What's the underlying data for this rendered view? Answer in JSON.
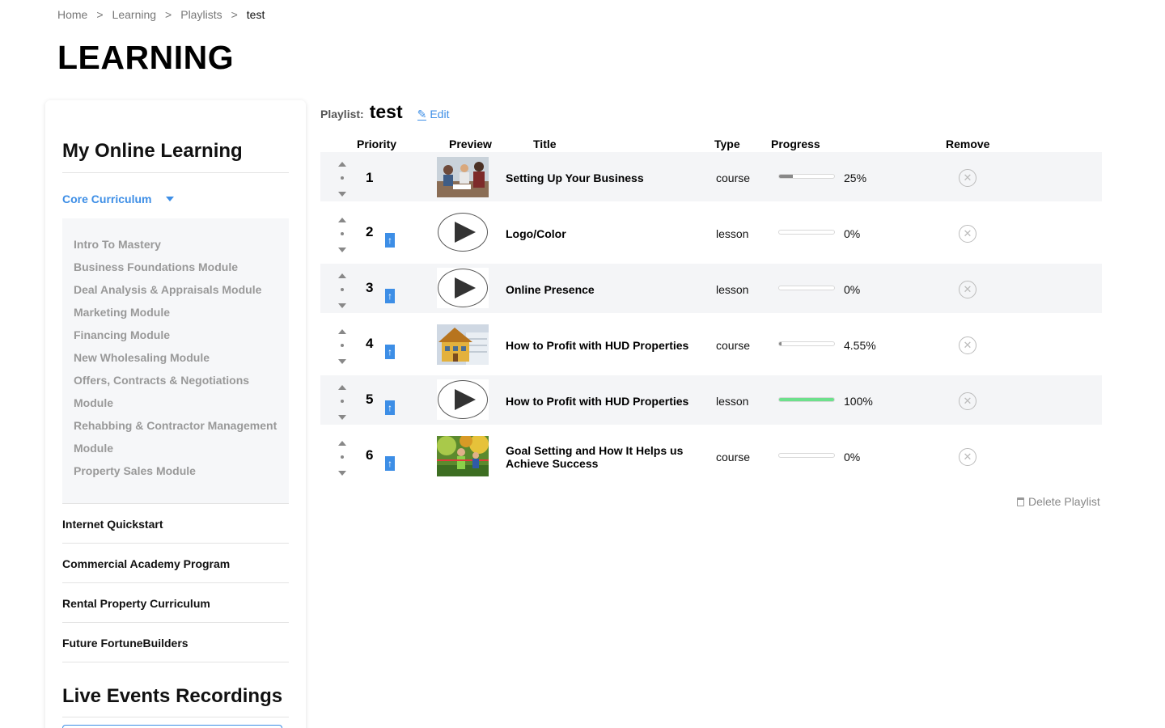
{
  "breadcrumb": {
    "items": [
      "Home",
      "Learning",
      "Playlists",
      "test"
    ],
    "separator": ">"
  },
  "page_title": "LEARNING",
  "sidebar": {
    "my_online_learning": "My Online Learning",
    "core_curriculum": "Core Curriculum",
    "modules": [
      "Intro To Mastery",
      "Business Foundations Module",
      "Deal Analysis & Appraisals Module",
      "Marketing Module",
      "Financing Module",
      "New Wholesaling Module",
      "Offers, Contracts & Negotiations",
      "Module",
      "Rehabbing & Contractor Management",
      "Module",
      "Property Sales Module"
    ],
    "programs": [
      "Internet Quickstart",
      "Commercial Academy Program",
      "Rental Property Curriculum",
      "Future FortuneBuilders"
    ],
    "live_events": "Live Events Recordings"
  },
  "playlist": {
    "label": "Playlist:",
    "name": "test",
    "edit_label": "Edit",
    "columns": {
      "priority": "Priority",
      "preview": "Preview",
      "title": "Title",
      "type": "Type",
      "progress": "Progress",
      "remove": "Remove"
    },
    "rows": [
      {
        "priority": "1",
        "title": "Setting Up Your Business",
        "type": "course",
        "progress_pct": 25,
        "progress_label": "25%",
        "preview": "office-photo"
      },
      {
        "priority": "2",
        "title": "Logo/Color",
        "type": "lesson",
        "progress_pct": 0,
        "progress_label": "0%",
        "preview": "play-icon"
      },
      {
        "priority": "3",
        "title": "Online Presence",
        "type": "lesson",
        "progress_pct": 0,
        "progress_label": "0%",
        "preview": "play-icon"
      },
      {
        "priority": "4",
        "title": "How to Profit with HUD Properties",
        "type": "course",
        "progress_pct": 4.55,
        "progress_label": "4.55%",
        "preview": "house-photo"
      },
      {
        "priority": "5",
        "title": "How to Profit with HUD Properties",
        "type": "lesson",
        "progress_pct": 100,
        "progress_label": "100%",
        "preview": "play-icon"
      },
      {
        "priority": "6",
        "title": "Goal Setting and How It Helps us Achieve Success",
        "type": "course",
        "progress_pct": 0,
        "progress_label": "0%",
        "preview": "finish-line-photo"
      }
    ],
    "move_to_top_icon": "arrow-up-icon",
    "remove_icon": "close-circle-icon",
    "delete_label": "Delete Playlist"
  },
  "colors": {
    "accent": "#3d8ee6",
    "progress_partial": "#888888",
    "progress_complete": "#6de08c"
  }
}
